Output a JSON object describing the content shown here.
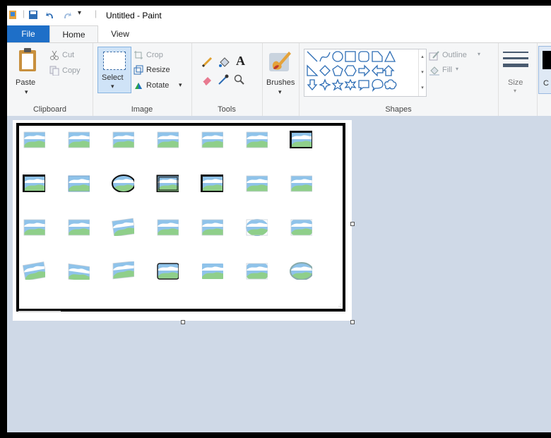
{
  "window": {
    "title": "Untitled - Paint"
  },
  "tabs": {
    "file": "File",
    "home": "Home",
    "view": "View"
  },
  "clipboard": {
    "paste": "Paste",
    "cut": "Cut",
    "copy": "Copy",
    "label": "Clipboard"
  },
  "image": {
    "select": "Select",
    "crop": "Crop",
    "resize": "Resize",
    "rotate": "Rotate",
    "label": "Image"
  },
  "tools": {
    "text_glyph": "A",
    "label": "Tools"
  },
  "brushes": {
    "label": "Brushes"
  },
  "shapes": {
    "outline": "Outline",
    "fill": "Fill",
    "label": "Shapes"
  },
  "size": {
    "label": "Size"
  },
  "colors": {
    "partial_label": "C"
  },
  "accent": {
    "file_tab": "#1e6fc8",
    "workarea": "#cfd9e7",
    "sky": "#8fc3ea",
    "hill": "#8fcf8a"
  }
}
